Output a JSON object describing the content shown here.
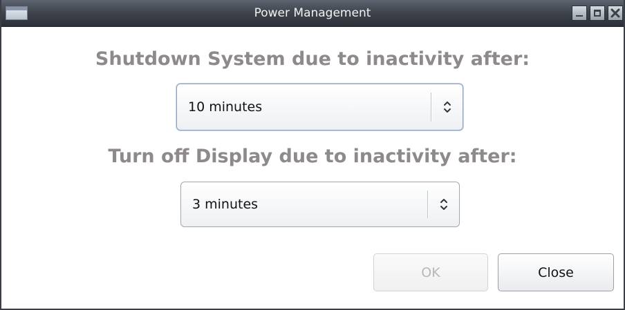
{
  "window": {
    "title": "Power Management"
  },
  "shutdown": {
    "heading": "Shutdown System due to inactivity after:",
    "selected": "10 minutes"
  },
  "display": {
    "heading": "Turn off Display due to inactivity after:",
    "selected": "3 minutes"
  },
  "buttons": {
    "ok_label": "OK",
    "ok_enabled": false,
    "close_label": "Close"
  },
  "icons": {
    "window_menu": "window-menu-icon",
    "minimize": "minimize-icon",
    "maximize": "maximize-icon",
    "close": "close-icon",
    "combo_arrow": "updown-chevron-icon"
  },
  "colors": {
    "heading": "#8e8a8c",
    "titlebar": "#40454e",
    "focus_border": "#8ba3c0",
    "disabled_text": "#b8b8b8"
  }
}
